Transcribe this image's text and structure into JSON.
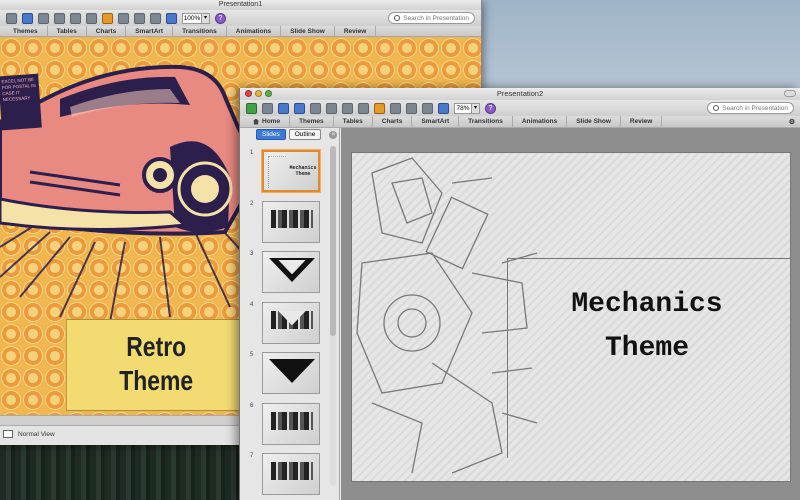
{
  "window1": {
    "title": "Presentation1",
    "zoom": "100%",
    "search_placeholder": "Search in Presentation",
    "tabs": [
      "Themes",
      "Tables",
      "Charts",
      "SmartArt",
      "Transitions",
      "Animations",
      "Slide Show",
      "Review"
    ],
    "slide": {
      "title_line1": "Retro",
      "title_line2": "Theme",
      "sticker_text": "EXCEL NOT BE FOR POSTAL IN CASE IT NECESSARY"
    },
    "status": "Normal View"
  },
  "window2": {
    "title": "Presentation2",
    "zoom": "78%",
    "search_placeholder": "Search in Presentation",
    "tabs": [
      "Home",
      "Themes",
      "Tables",
      "Charts",
      "SmartArt",
      "Transitions",
      "Animations",
      "Slide Show",
      "Review"
    ],
    "pane_tabs": {
      "slides": "Slides",
      "outline": "Outline"
    },
    "thumbnails": [
      {
        "num": "1",
        "label": "Mechanics Theme"
      },
      {
        "num": "2"
      },
      {
        "num": "3"
      },
      {
        "num": "4"
      },
      {
        "num": "5"
      },
      {
        "num": "6"
      },
      {
        "num": "7"
      }
    ],
    "slide": {
      "title_line1": "Mechanics",
      "title_line2": "Theme"
    }
  },
  "colors": {
    "retro_bg": "#f1b74e",
    "retro_box": "#f2dc72",
    "car_body": "#e98a82",
    "car_outline": "#2c1f4b",
    "selection": "#e08a2a",
    "tab_active": "#3b7ad6"
  }
}
